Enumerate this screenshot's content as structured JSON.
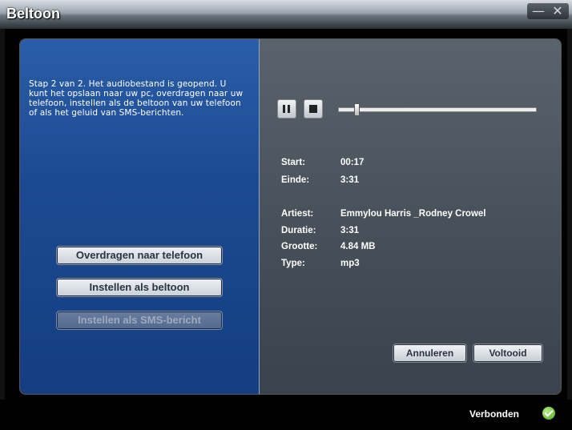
{
  "window": {
    "title": "Beltoon",
    "minimize_icon": "—",
    "close_icon": "✕"
  },
  "left": {
    "instruction": "Stap 2 van 2. Het audiobestand is geopend. U kunt het opslaan naar uw pc, overdragen naar uw telefoon, instellen als de beltoon van uw telefoon of als het geluid van SMS-berichten.",
    "buttons": [
      {
        "label": "Overdragen naar telefoon",
        "enabled": true
      },
      {
        "label": "Instellen als beltoon",
        "enabled": true
      },
      {
        "label": "Instellen als SMS-bericht",
        "enabled": false
      }
    ]
  },
  "player": {
    "controls": [
      "pause-icon",
      "stop-icon"
    ],
    "position_fraction": 0.08,
    "start_label": "Start:",
    "start_value": "00:17",
    "end_label": "Einde:",
    "end_value": "3:31"
  },
  "details": {
    "artist_label": "Artiest:",
    "artist_value": "Emmylou Harris _Rodney Crowel",
    "duration_label": "Duratie:",
    "duration_value": "3:31",
    "size_label": "Grootte:",
    "size_value": "4.84 MB",
    "type_label": "Type:",
    "type_value": "mp3"
  },
  "actions": {
    "cancel": "Annuleren",
    "done": "Voltooid"
  },
  "status": {
    "text": "Verbonden",
    "icon": "connected-check-icon",
    "color": "#4aa71e"
  }
}
